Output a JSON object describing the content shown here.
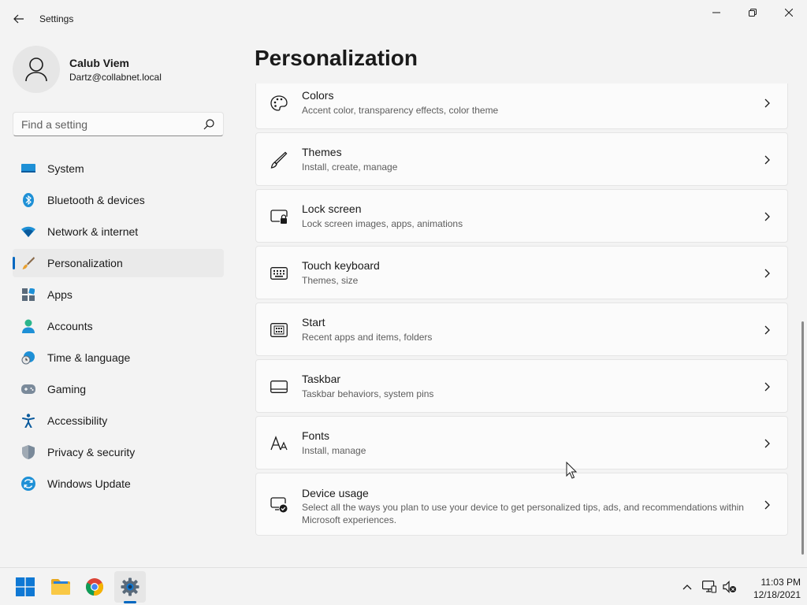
{
  "window": {
    "title": "Settings"
  },
  "user": {
    "name": "Calub Viem",
    "email": "Dartz@collabnet.local"
  },
  "search": {
    "placeholder": "Find a setting"
  },
  "sidebar": {
    "items": [
      {
        "label": "System",
        "icon": "system-icon"
      },
      {
        "label": "Bluetooth & devices",
        "icon": "bluetooth-icon"
      },
      {
        "label": "Network & internet",
        "icon": "wifi-icon"
      },
      {
        "label": "Personalization",
        "icon": "brush-icon",
        "selected": true
      },
      {
        "label": "Apps",
        "icon": "apps-icon"
      },
      {
        "label": "Accounts",
        "icon": "accounts-icon"
      },
      {
        "label": "Time & language",
        "icon": "clock-globe-icon"
      },
      {
        "label": "Gaming",
        "icon": "gamepad-icon"
      },
      {
        "label": "Accessibility",
        "icon": "accessibility-icon"
      },
      {
        "label": "Privacy & security",
        "icon": "shield-icon"
      },
      {
        "label": "Windows Update",
        "icon": "update-icon"
      }
    ]
  },
  "main": {
    "title": "Personalization",
    "cards": [
      {
        "title": "Colors",
        "subtitle": "Accent color, transparency effects, color theme",
        "icon": "palette-icon"
      },
      {
        "title": "Themes",
        "subtitle": "Install, create, manage",
        "icon": "pen-icon"
      },
      {
        "title": "Lock screen",
        "subtitle": "Lock screen images, apps, animations",
        "icon": "lock-screen-icon"
      },
      {
        "title": "Touch keyboard",
        "subtitle": "Themes, size",
        "icon": "keyboard-icon"
      },
      {
        "title": "Start",
        "subtitle": "Recent apps and items, folders",
        "icon": "start-icon"
      },
      {
        "title": "Taskbar",
        "subtitle": "Taskbar behaviors, system pins",
        "icon": "taskbar-icon"
      },
      {
        "title": "Fonts",
        "subtitle": "Install, manage",
        "icon": "fonts-icon"
      },
      {
        "title": "Device usage",
        "subtitle": "Select all the ways you plan to use your device to get personalized tips, ads, and recommendations within Microsoft experiences.",
        "icon": "device-usage-icon"
      }
    ]
  },
  "taskbar": {
    "time": "11:03 PM",
    "date": "12/18/2021"
  },
  "colors": {
    "accent": "#0067c0",
    "background": "#f3f3f3",
    "card": "#fbfbfb"
  }
}
